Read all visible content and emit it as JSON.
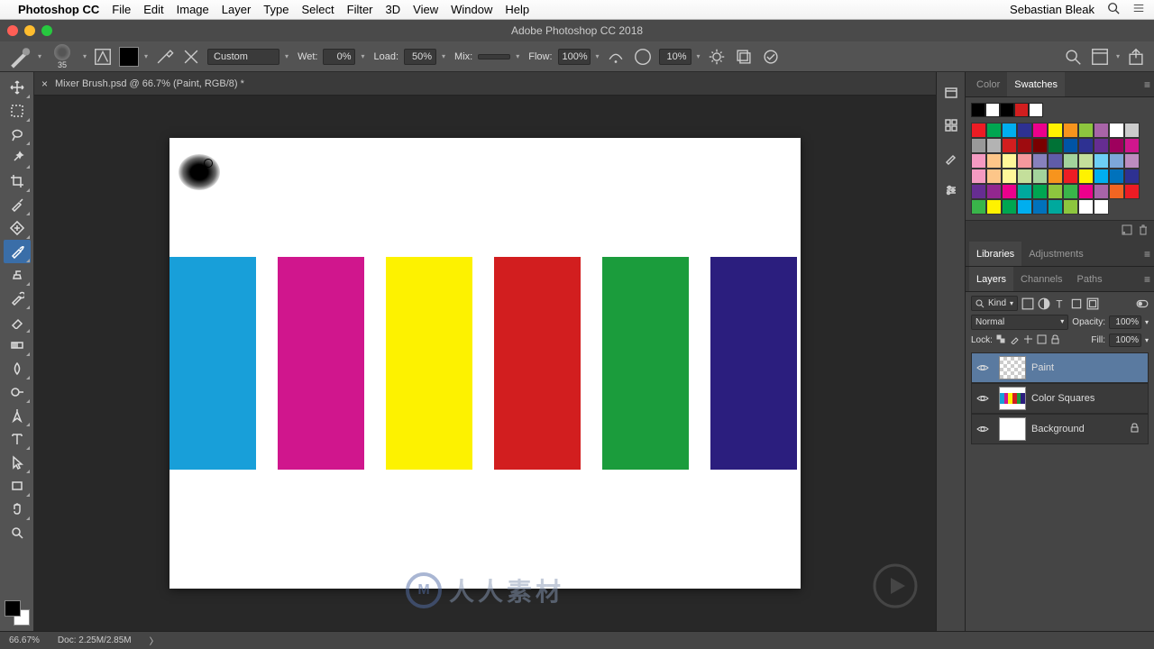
{
  "mac": {
    "app": "Photoshop CC",
    "menus": [
      "File",
      "Edit",
      "Image",
      "Layer",
      "Type",
      "Select",
      "Filter",
      "3D",
      "View",
      "Window",
      "Help"
    ],
    "user": "Sebastian Bleak"
  },
  "window": {
    "title": "Adobe Photoshop CC 2018"
  },
  "options": {
    "brush_size": "35",
    "preset": "Custom",
    "wet_label": "Wet:",
    "wet_value": "0%",
    "load_label": "Load:",
    "load_value": "50%",
    "mix_label": "Mix:",
    "mix_value": "",
    "flow_label": "Flow:",
    "flow_value": "100%",
    "airbrush_value": "10%"
  },
  "doc": {
    "tab_title": "Mixer Brush.psd @ 66.7% (Paint, RGB/8) *",
    "bars": [
      "#189fd9",
      "#d0168d",
      "#fdf200",
      "#d21e1f",
      "#1b9c3c",
      "#2b1e7e"
    ]
  },
  "right_panels": {
    "color_tab": "Color",
    "swatches_tab": "Swatches",
    "libraries_tab": "Libraries",
    "adjustments_tab": "Adjustments",
    "layers_tab": "Layers",
    "channels_tab": "Channels",
    "paths_tab": "Paths"
  },
  "swatches": {
    "recent": [
      "#000000",
      "#ffffff",
      "#000000",
      "#d21e1f",
      "#ffffff"
    ],
    "grid": [
      "#ed1c24",
      "#00a651",
      "#00aeef",
      "#2e3192",
      "#ec008c",
      "#fff200",
      "#f7941d",
      "#8dc63e",
      "#a864a8",
      "#ffffff",
      "#cccccc",
      "#999999",
      "#b3b3b3",
      "#d21e1f",
      "#9e0b0f",
      "#790000",
      "#007236",
      "#0054a6",
      "#2e3192",
      "#662d91",
      "#9e005d",
      "#d0168d",
      "#f49ac1",
      "#fdc689",
      "#fff799",
      "#f5989d",
      "#8781bd",
      "#605ca8",
      "#a3d39c",
      "#c4df9b",
      "#6dcff6",
      "#7da7d9",
      "#bd8cbf",
      "#f49ac1",
      "#fdc689",
      "#fff799",
      "#c4df9b",
      "#a3d39c",
      "#f7941d",
      "#ed1c24",
      "#fff200",
      "#00aeef",
      "#0072bc",
      "#2e3192",
      "#662d91",
      "#92278f",
      "#ec008c",
      "#00a99d",
      "#00a651",
      "#8dc63e",
      "#39b54a",
      "#ec008c",
      "#a864a8",
      "#f26522",
      "#ed1c24",
      "#39b54a",
      "#fff200",
      "#00a651",
      "#00aeef",
      "#0072bc",
      "#00a99d",
      "#8dc63e",
      "#ffffff",
      "#ffffff"
    ]
  },
  "layers": {
    "kind_label": "Kind",
    "blend_mode": "Normal",
    "opacity_label": "Opacity:",
    "opacity_value": "100%",
    "lock_label": "Lock:",
    "fill_label": "Fill:",
    "fill_value": "100%",
    "items": [
      {
        "name": "Paint",
        "thumb": "checker",
        "selected": true,
        "locked": false
      },
      {
        "name": "Color Squares",
        "thumb": "bars",
        "selected": false,
        "locked": false
      },
      {
        "name": "Background",
        "thumb": "white",
        "selected": false,
        "locked": true
      }
    ]
  },
  "status": {
    "zoom": "66.67%",
    "doc_size": "Doc: 2.25M/2.85M"
  },
  "watermark": "人人素材"
}
